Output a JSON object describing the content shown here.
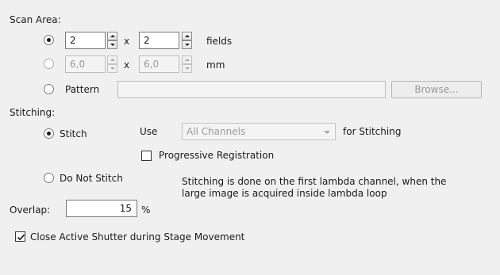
{
  "scan_area": {
    "title": "Scan Area:",
    "fields_row": {
      "value_x": "2",
      "value_y": "2",
      "times": "x",
      "unit": "fields",
      "selected": true
    },
    "mm_row": {
      "value_x": "6,0",
      "value_y": "6,0",
      "times": "x",
      "unit": "mm",
      "selected": false
    },
    "pattern_row": {
      "label": "Pattern",
      "value": "",
      "browse_label": "Browse...",
      "selected": false
    }
  },
  "stitching": {
    "title": "Stitching:",
    "stitch_label": "Stitch",
    "stitch_selected": true,
    "use_label": "Use",
    "channel_value": "All Channels",
    "for_label": "for Stitching",
    "progressive_label": "Progressive Registration",
    "progressive_checked": false,
    "do_not_stitch_label": "Do Not Stitch",
    "note_line1": "Stitching is done on the first lambda channel, when the",
    "note_line2": "large image is acquired inside lambda loop"
  },
  "overlap": {
    "label": "Overlap:",
    "value": "15",
    "unit": "%"
  },
  "close_shutter": {
    "label": "Close Active Shutter during Stage Movement",
    "checked": true
  }
}
